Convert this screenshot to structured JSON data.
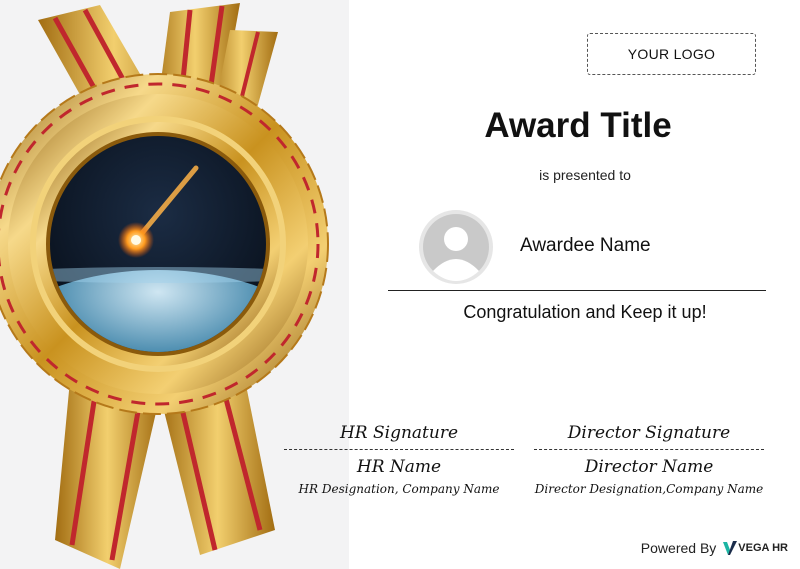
{
  "logo": {
    "text": "YOUR LOGO"
  },
  "award": {
    "title": "Award Title",
    "presented_text": "is presented to",
    "awardee_name": "Awardee Name",
    "message": "Congratulation and Keep it up!"
  },
  "signatures": {
    "hr": {
      "signature": "HR Signature",
      "name": "HR Name",
      "designation": "HR Designation, Company Name"
    },
    "director": {
      "signature": "Director Signature",
      "name": "Director Name",
      "designation": "Director Designation,Company Name"
    }
  },
  "footer": {
    "powered_by": "Powered By",
    "brand": "VEGA HR"
  },
  "colors": {
    "gold": "#d4a21f",
    "ribbon_red": "#c0272d",
    "space": "#0b1a2b",
    "brand_teal": "#1cb5a3"
  }
}
